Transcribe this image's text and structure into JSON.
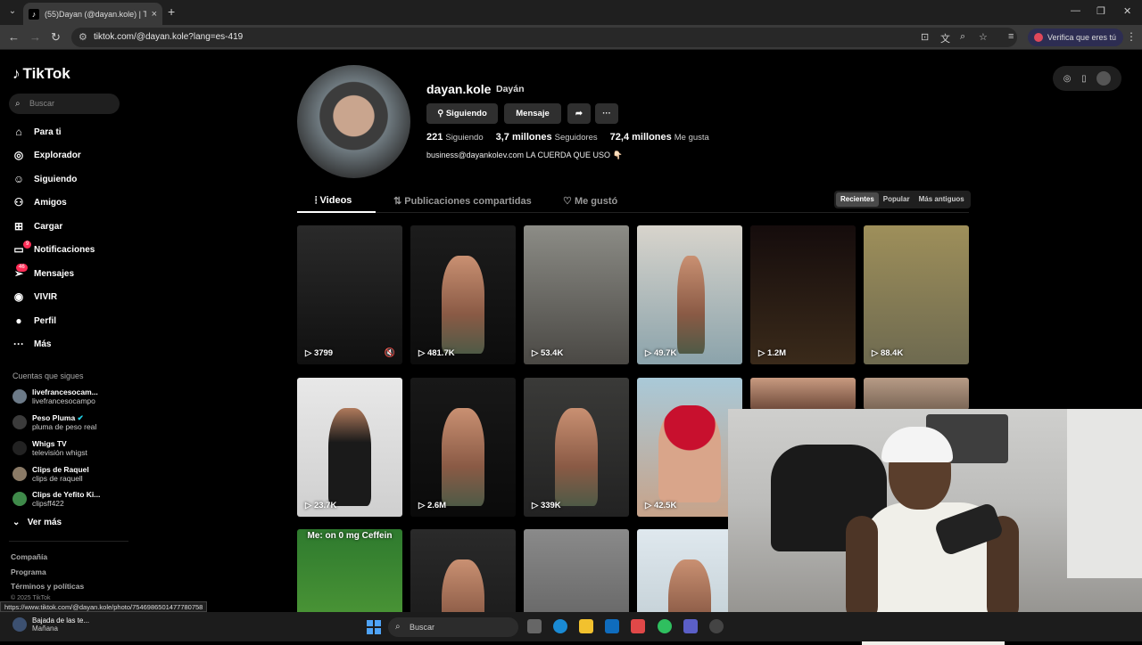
{
  "browser": {
    "tab_title": "(55)Dayan (@dayan.kole) | TikTo",
    "url": "tiktok.com/@dayan.kole?lang=es-419",
    "verify_label": "Verifica que eres tú"
  },
  "sidebar": {
    "logo": "TikTok",
    "search_placeholder": "Buscar",
    "items": [
      {
        "label": "Para ti",
        "icon": "home-icon"
      },
      {
        "label": "Explorador",
        "icon": "compass-icon"
      },
      {
        "label": "Siguiendo",
        "icon": "user-follow-icon"
      },
      {
        "label": "Amigos",
        "icon": "friends-icon"
      },
      {
        "label": "Cargar",
        "icon": "upload-icon"
      },
      {
        "label": "Notificaciones",
        "icon": "inbox-icon",
        "badge": "9"
      },
      {
        "label": "Mensajes",
        "icon": "send-icon",
        "badge": "46"
      },
      {
        "label": "VIVIR",
        "icon": "live-icon"
      },
      {
        "label": "Perfil",
        "icon": "profile-icon"
      },
      {
        "label": "Más",
        "icon": "ellipsis-icon"
      }
    ],
    "following_title": "Cuentas que sigues",
    "following": [
      {
        "name": "livefrancesocam...",
        "handle": "livefrancesocampo"
      },
      {
        "name": "Peso Pluma",
        "handle": "pluma de peso real",
        "verified": true
      },
      {
        "name": "Whigs TV",
        "handle": "televisión whigst"
      },
      {
        "name": "Clips de Raquel",
        "handle": "clips de raquell"
      },
      {
        "name": "Clips de Yefito Ki...",
        "handle": "clipsff422"
      }
    ],
    "see_more": "Ver más",
    "footer": [
      "Compañía",
      "Programa",
      "Términos y políticas"
    ],
    "copyright": "© 2025 TikTok"
  },
  "status_url": "https://www.tiktok.com/@dayan.kole/photo/7546986501477780758",
  "profile": {
    "username": "dayan.kole",
    "display_name": "Dayán",
    "following_btn": "Siguiendo",
    "message_btn": "Mensaje",
    "stats": [
      {
        "value": "221",
        "label": "Siguiendo"
      },
      {
        "value": "3,7 millones",
        "label": "Seguidores"
      },
      {
        "value": "72,4 millones",
        "label": "Me gusta"
      }
    ],
    "bio": "business@dayankolev.com LA CUERDA QUE USO 👇🏻"
  },
  "tabs": [
    "Videos",
    "Publicaciones compartidas",
    "Me gustó"
  ],
  "sort": [
    "Recientes",
    "Popular",
    "Más antiguos"
  ],
  "videos": [
    {
      "views": "3799"
    },
    {
      "views": "481.7K"
    },
    {
      "views": "53.4K"
    },
    {
      "views": "49.7K"
    },
    {
      "views": "1.2M"
    },
    {
      "views": "88.4K"
    },
    {
      "views": "23.7K"
    },
    {
      "views": "2.6M"
    },
    {
      "views": "339K"
    },
    {
      "views": "42.5K"
    },
    {
      "caption": "Me: on 0 mg Ceffein"
    }
  ],
  "taskbar": {
    "news_title": "Bajada de las te...",
    "news_sub": "Mañana",
    "search": "Buscar"
  }
}
